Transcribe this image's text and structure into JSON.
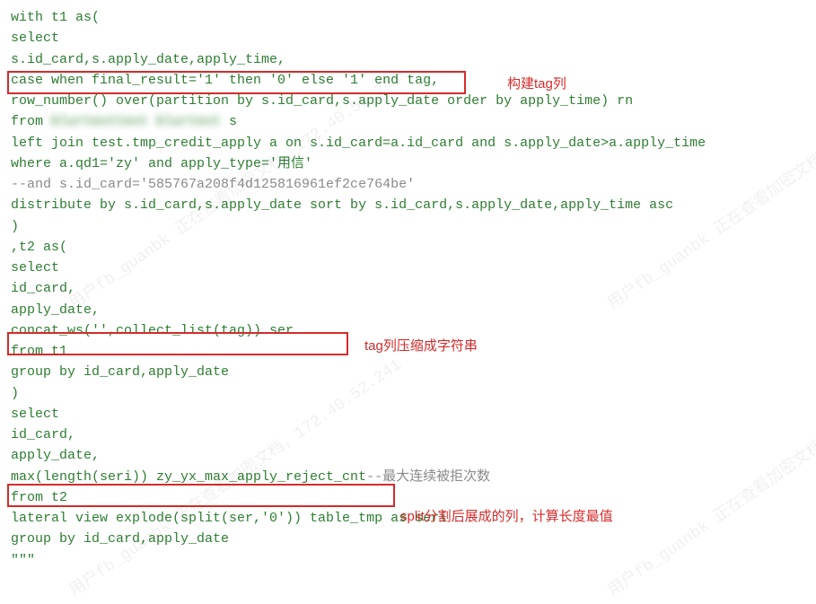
{
  "code": {
    "l1": "with t1 as(",
    "l2": "select",
    "l3": "s.id_card,s.apply_date,apply_time,",
    "l4": "case when final_result='1' then '0' else '1' end tag,",
    "l5": "row_number() over(partition by s.id_card,s.apply_date order by apply_time) rn",
    "l6a": "from ",
    "l6b": "blurtexttext blurtext",
    "l6c": " s",
    "l7": "left join test.tmp_credit_apply a on s.id_card=a.id_card and s.apply_date>a.apply_time",
    "l8": "where a.qd1='zy' and apply_type='用信'",
    "l9": "--and s.id_card='585767a208f4d125816961ef2ce764be'",
    "l10": "distribute by s.id_card,s.apply_date sort by s.id_card,s.apply_date,apply_time asc",
    "l11": ")",
    "l12": ",t2 as(",
    "l13": "select",
    "l14": "id_card,",
    "l15": "apply_date,",
    "l16": "concat_ws('',collect_list(tag)) ser",
    "l17": "from t1",
    "l18": "group by id_card,apply_date",
    "l19": ")",
    "l20": "select",
    "l21": "id_card,",
    "l22": "apply_date,",
    "l23a": "max(length(seri)) zy_yx_max_apply_reject_cnt",
    "l23b": "--最大连续被拒次数",
    "l24": "from t2",
    "l25": "lateral view explode(split(ser,'0')) table_tmp as seri",
    "l26": "group by id_card,apply_date",
    "l27": "\"\"\""
  },
  "annotations": {
    "a1": "构建tag列",
    "a2": "tag列压缩成字符串",
    "a3": "split分割后展成的列，计算长度最值"
  },
  "watermark_text": "用户fb_guanbk 正在查看加密文档，172.40.52.241"
}
